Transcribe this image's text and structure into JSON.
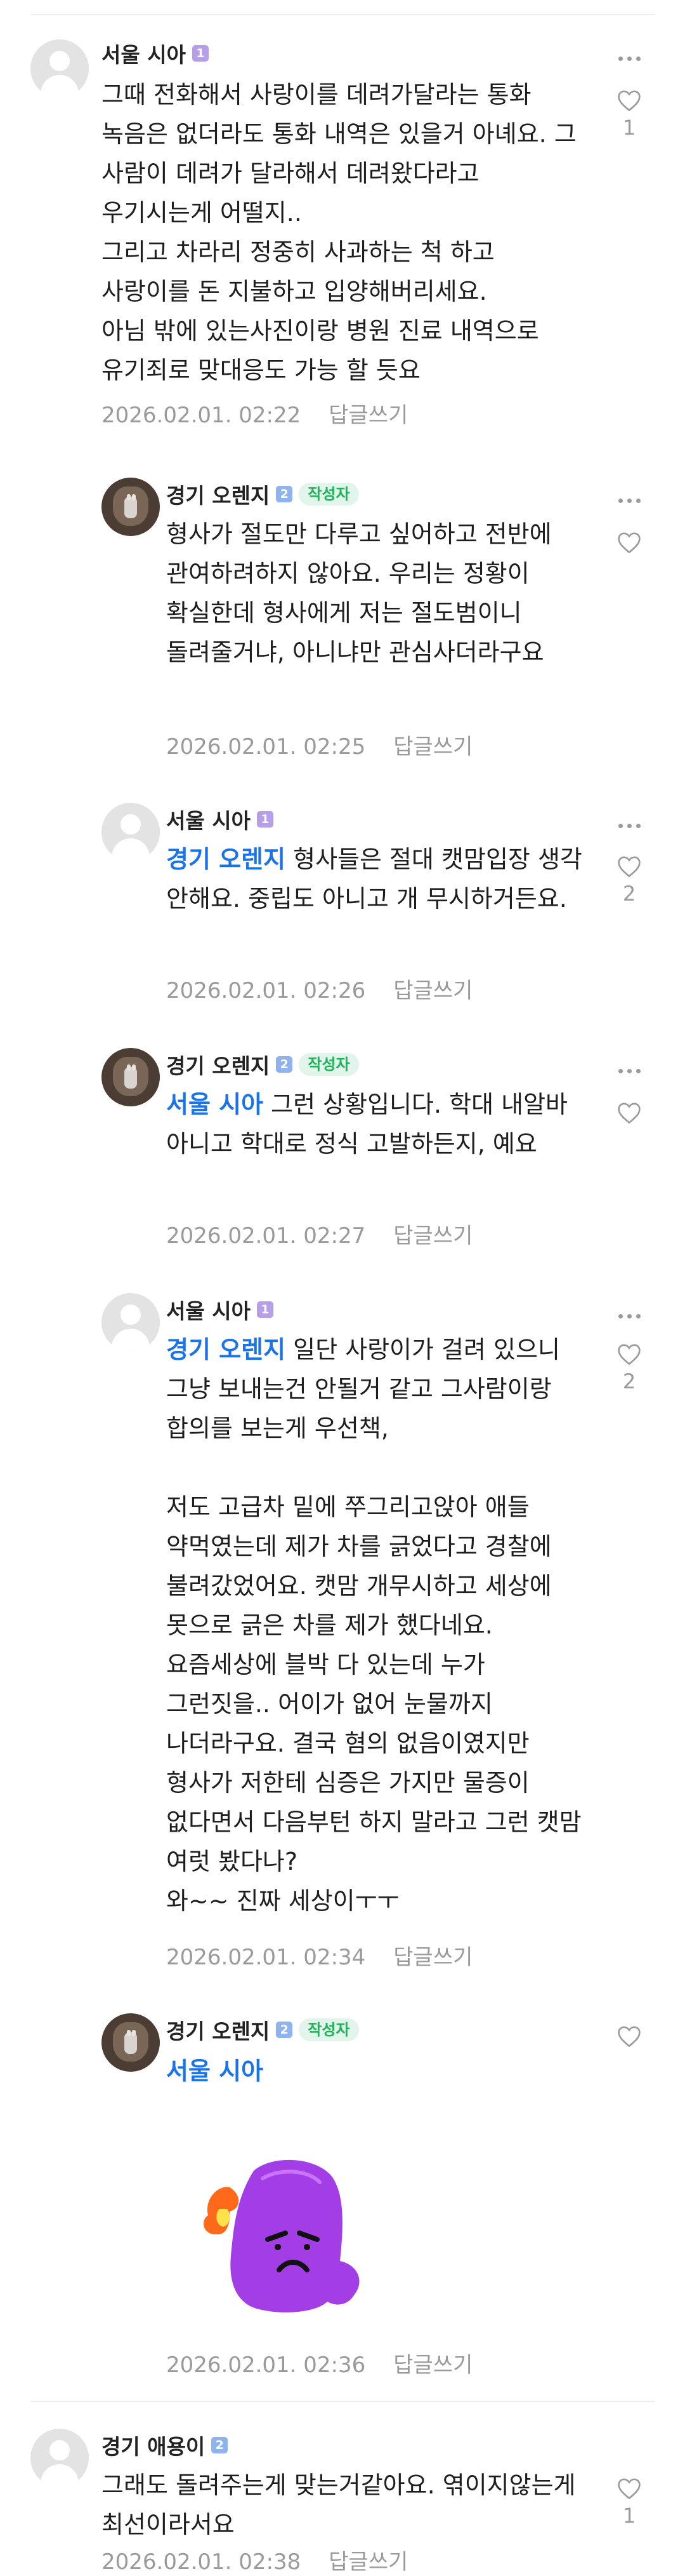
{
  "comments": [
    {
      "user": "서울 시아",
      "level": "1",
      "text": "그때 전화해서 사랑이를 데려가달라는 통화 녹음은 없더라도 통화 내역은 있을거 아녜요. 그 사람이 데려가 달라해서 데려왔다라고 우기시는게 어떨지..\n그리고 차라리 정중히 사과하는 척 하고 사랑이를 돈 지불하고 입양해버리세요.\n아님 밖에 있는사진이랑 병원 진료 내역으로 유기죄로 맞대응도 가능 할 듯요",
      "date": "2026.02.01. 02:22",
      "reply_label": "답글쓰기",
      "likes": "1"
    },
    {
      "user": "경기 오렌지",
      "level": "2",
      "badge": "작성자",
      "text": "형사가 절도만 다루고 싶어하고 전반에 관여하려하지 않아요. 우리는 정황이 확실한데 형사에게 저는 절도범이니 돌려줄거냐, 아니냐만 관심사더라구요",
      "date": "2026.02.01. 02:25",
      "reply_label": "답글쓰기",
      "likes": ""
    },
    {
      "user": "서울 시아",
      "level": "1",
      "mention": "경기 오렌지",
      "text": " 형사들은 절대 캣맘입장 생각 안해요. 중립도 아니고 개 무시하거든요.",
      "date": "2026.02.01. 02:26",
      "reply_label": "답글쓰기",
      "likes": "2"
    },
    {
      "user": "경기 오렌지",
      "level": "2",
      "badge": "작성자",
      "mention": "서울 시아",
      "text": " 그런 상황입니다. 학대 내알바 아니고 학대로 정식 고발하든지, 예요",
      "date": "2026.02.01. 02:27",
      "reply_label": "답글쓰기",
      "likes": ""
    },
    {
      "user": "서울 시아",
      "level": "1",
      "mention": "경기 오렌지",
      "text": " 일단 사랑이가 걸려 있으니 그냥 보내는건 안될거 같고 그사람이랑 합의를 보는게 우선책,\n\n저도 고급차 밑에 쭈그리고앉아 애들 약먹였는데 제가 차를 긁었다고 경찰에 불려갔었어요. 캣맘 개무시하고 세상에 못으로 긁은 차를 제가 했다네요. 요즘세상에 블박 다 있는데 누가 그런짓을.. 어이가 없어 눈물까지 나더라구요. 결국 혐의 없음이였지만 형사가 저한테 심증은 가지만 물증이 없다면서 다음부턴 하지 말라고 그런 캣맘 여럿 봤다나?\n와~~ 진짜 세상이ㅜㅜ",
      "date": "2026.02.01. 02:34",
      "reply_label": "답글쓰기",
      "likes": "2"
    },
    {
      "user": "경기 오렌지",
      "level": "2",
      "badge": "작성자",
      "mention": "서울 시아",
      "text": "",
      "sticker": "angry-purple-blob-sticker",
      "date": "2026.02.01. 02:36",
      "reply_label": "답글쓰기",
      "likes": ""
    },
    {
      "user": "경기 애용이",
      "level": "2",
      "text": "그래도 돌려주는게 맞는거같아요. 엮이지않는게 최선이라서요",
      "date": "2026.02.01. 02:38",
      "reply_label": "답글쓰기",
      "likes": "1"
    }
  ],
  "colors": {
    "mention": "#1a73e8",
    "author_badge": "#1fb35a",
    "meta": "#9a9a9a"
  }
}
